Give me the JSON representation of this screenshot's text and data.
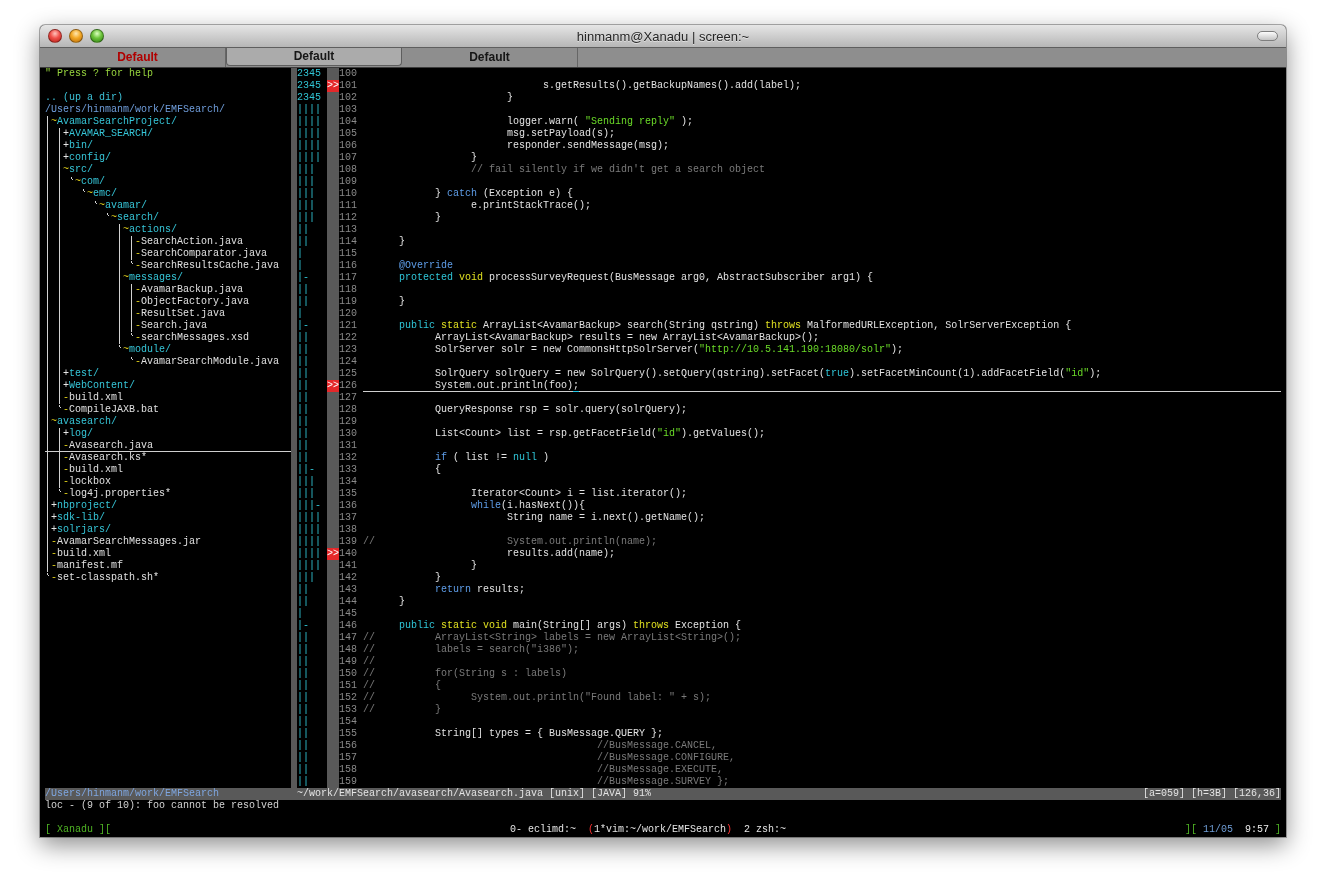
{
  "window": {
    "title": "hinmanm@Xanadu | screen:~"
  },
  "tabs": [
    {
      "label": "Default",
      "selected": false,
      "alert": true
    },
    {
      "label": "Default",
      "selected": true,
      "alert": false
    },
    {
      "label": "Default",
      "selected": false,
      "alert": false
    }
  ],
  "file_tree": {
    "help": "\" Press ? for help",
    "up_dir": ".. (up a dir)",
    "root": "/Users/hinmanm/work/EMFSearch/",
    "nodes": [
      {
        "name": "AvamarSearchProject/",
        "marker": "~",
        "kind": "dir",
        "expanded": true,
        "children": [
          {
            "name": "AVAMAR_SEARCH/",
            "marker": "+",
            "kind": "dir",
            "expanded": false
          },
          {
            "name": "bin/",
            "marker": "+",
            "kind": "dir",
            "expanded": false
          },
          {
            "name": "config/",
            "marker": "+",
            "kind": "dir",
            "expanded": false
          },
          {
            "name": "src/",
            "marker": "~",
            "kind": "dir",
            "expanded": true,
            "children": [
              {
                "name": "com/",
                "marker": "~",
                "kind": "dir",
                "expanded": true,
                "children": [
                  {
                    "name": "emc/",
                    "marker": "~",
                    "kind": "dir",
                    "expanded": true,
                    "children": [
                      {
                        "name": "avamar/",
                        "marker": "~",
                        "kind": "dir",
                        "expanded": true,
                        "children": [
                          {
                            "name": "search/",
                            "marker": "~",
                            "kind": "dir",
                            "expanded": true,
                            "children": [
                              {
                                "name": "actions/",
                                "marker": "~",
                                "kind": "dir",
                                "expanded": true,
                                "children": [
                                  {
                                    "name": "SearchAction.java",
                                    "marker": "-",
                                    "kind": "file"
                                  },
                                  {
                                    "name": "SearchComparator.java",
                                    "marker": "-",
                                    "kind": "file"
                                  },
                                  {
                                    "name": "SearchResultsCache.java",
                                    "marker": "-",
                                    "kind": "file"
                                  }
                                ]
                              },
                              {
                                "name": "messages/",
                                "marker": "~",
                                "kind": "dir",
                                "expanded": true,
                                "children": [
                                  {
                                    "name": "AvamarBackup.java",
                                    "marker": "-",
                                    "kind": "file"
                                  },
                                  {
                                    "name": "ObjectFactory.java",
                                    "marker": "-",
                                    "kind": "file"
                                  },
                                  {
                                    "name": "ResultSet.java",
                                    "marker": "-",
                                    "kind": "file"
                                  },
                                  {
                                    "name": "Search.java",
                                    "marker": "-",
                                    "kind": "file"
                                  },
                                  {
                                    "name": "searchMessages.xsd",
                                    "marker": "-",
                                    "kind": "file"
                                  }
                                ]
                              },
                              {
                                "name": "module/",
                                "marker": "~",
                                "kind": "dir",
                                "expanded": true,
                                "children": [
                                  {
                                    "name": "AvamarSearchModule.java",
                                    "marker": "-",
                                    "kind": "file"
                                  }
                                ]
                              }
                            ]
                          }
                        ]
                      }
                    ]
                  }
                ]
              }
            ]
          },
          {
            "name": "test/",
            "marker": "+",
            "kind": "dir",
            "expanded": false
          },
          {
            "name": "WebContent/",
            "marker": "+",
            "kind": "dir",
            "expanded": false
          },
          {
            "name": "build.xml",
            "marker": "-",
            "kind": "file"
          },
          {
            "name": "CompileJAXB.bat",
            "marker": "-",
            "kind": "file"
          }
        ]
      },
      {
        "name": "avasearch/",
        "marker": "~",
        "kind": "dir",
        "expanded": true,
        "children": [
          {
            "name": "log/",
            "marker": "+",
            "kind": "dir",
            "expanded": false
          },
          {
            "name": "Avasearch.java",
            "marker": "-",
            "kind": "file",
            "cursor_line": true
          },
          {
            "name": "Avasearch.ks*",
            "marker": "-",
            "kind": "file"
          },
          {
            "name": "build.xml",
            "marker": "-",
            "kind": "file"
          },
          {
            "name": "lockbox",
            "marker": "-",
            "kind": "file"
          },
          {
            "name": "log4j.properties*",
            "marker": "-",
            "kind": "file"
          }
        ]
      },
      {
        "name": "nbproject/",
        "marker": "+",
        "kind": "dir",
        "expanded": false
      },
      {
        "name": "sdk-lib/",
        "marker": "+",
        "kind": "dir",
        "expanded": false
      },
      {
        "name": "solrjars/",
        "marker": "+",
        "kind": "dir",
        "expanded": false
      },
      {
        "name": "AvamarSearchMessages.jar",
        "marker": "-",
        "kind": "file"
      },
      {
        "name": "build.xml",
        "marker": "-",
        "kind": "file"
      },
      {
        "name": "manifest.mf",
        "marker": "-",
        "kind": "file"
      },
      {
        "name": "set-classpath.sh*",
        "marker": "-",
        "kind": "file"
      }
    ]
  },
  "editor": {
    "lines": [
      {
        "number": "100",
        "fold": "2345"
      },
      {
        "number": "101",
        "fold": "2345",
        "sign": ">>",
        "segments": [
          {
            "kind": "plain",
            "text": "\t\t\t\t\ts.getResults().getBackupNames().add(label);"
          }
        ]
      },
      {
        "number": "102",
        "fold": "2345",
        "segments": [
          {
            "kind": "plain",
            "text": "\t\t\t\t}"
          }
        ]
      },
      {
        "number": "103",
        "fold": "||||"
      },
      {
        "number": "104",
        "fold": "||||",
        "segments": [
          {
            "kind": "plain",
            "text": "\t\t\t\tlogger.warn( "
          },
          {
            "kind": "string",
            "text": "\"Sending reply\""
          },
          {
            "kind": "plain",
            "text": " );"
          }
        ]
      },
      {
        "number": "105",
        "fold": "||||",
        "segments": [
          {
            "kind": "plain",
            "text": "\t\t\t\tmsg.setPayload(s);"
          }
        ]
      },
      {
        "number": "106",
        "fold": "||||",
        "segments": [
          {
            "kind": "plain",
            "text": "\t\t\t\tresponder.sendMessage(msg);"
          }
        ]
      },
      {
        "number": "107",
        "fold": "||||",
        "segments": [
          {
            "kind": "plain",
            "text": "\t\t\t}"
          }
        ]
      },
      {
        "number": "108",
        "fold": "|||",
        "segments": [
          {
            "kind": "comment",
            "text": "\t\t\t// fail silently if we didn't get a search object"
          }
        ]
      },
      {
        "number": "109",
        "fold": "|||"
      },
      {
        "number": "110",
        "fold": "|||",
        "segments": [
          {
            "kind": "plain",
            "text": "\t\t} "
          },
          {
            "kind": "statement",
            "text": "catch"
          },
          {
            "kind": "plain",
            "text": " (Exception e) {"
          }
        ]
      },
      {
        "number": "111",
        "fold": "|||",
        "segments": [
          {
            "kind": "plain",
            "text": "\t\t\te.printStackTrace();"
          }
        ]
      },
      {
        "number": "112",
        "fold": "|||",
        "segments": [
          {
            "kind": "plain",
            "text": "\t\t}"
          }
        ]
      },
      {
        "number": "113",
        "fold": "||"
      },
      {
        "number": "114",
        "fold": "||",
        "segments": [
          {
            "kind": "plain",
            "text": "\t}"
          }
        ]
      },
      {
        "number": "115",
        "fold": "|"
      },
      {
        "number": "116",
        "fold": "|",
        "segments": [
          {
            "kind": "annotation",
            "text": "\t@Override"
          }
        ]
      },
      {
        "number": "117",
        "fold": "|-",
        "segments": [
          {
            "kind": "keyword",
            "text": "\tprotected"
          },
          {
            "kind": "type",
            "text": " void"
          },
          {
            "kind": "plain",
            "text": " processSurveyRequest(BusMessage arg0, AbstractSubscriber arg1) {"
          }
        ]
      },
      {
        "number": "118",
        "fold": "||"
      },
      {
        "number": "119",
        "fold": "||",
        "segments": [
          {
            "kind": "plain",
            "text": "\t}"
          }
        ]
      },
      {
        "number": "120",
        "fold": "|"
      },
      {
        "number": "121",
        "fold": "|-",
        "segments": [
          {
            "kind": "keyword",
            "text": "\tpublic"
          },
          {
            "kind": "type",
            "text": " static"
          },
          {
            "kind": "plain",
            "text": " ArrayList<AvamarBackup> search(String qstring) "
          },
          {
            "kind": "type",
            "text": "throws"
          },
          {
            "kind": "plain",
            "text": " MalformedURLException, SolrServerException {"
          }
        ]
      },
      {
        "number": "122",
        "fold": "||",
        "segments": [
          {
            "kind": "plain",
            "text": "\t\tArrayList<AvamarBackup> results = new ArrayList<AvamarBackup>();"
          }
        ]
      },
      {
        "number": "123",
        "fold": "||",
        "segments": [
          {
            "kind": "plain",
            "text": "\t\tSolrServer solr = new CommonsHttpSolrServer("
          },
          {
            "kind": "string",
            "text": "\"http://10.5.141.190:18080/solr\""
          },
          {
            "kind": "plain",
            "text": ");"
          }
        ]
      },
      {
        "number": "124",
        "fold": "||"
      },
      {
        "number": "125",
        "fold": "||",
        "segments": [
          {
            "kind": "plain",
            "text": "\t\tSolrQuery solrQuery = new SolrQuery().setQuery(qstring).setFacet("
          },
          {
            "kind": "keyword",
            "text": "true"
          },
          {
            "kind": "plain",
            "text": ").setFacetMinCount(1).addFacetField("
          },
          {
            "kind": "string",
            "text": "\"id\""
          },
          {
            "kind": "plain",
            "text": ");"
          }
        ]
      },
      {
        "number": "126",
        "fold": "||",
        "sign": ">>",
        "cursor_line": true,
        "segments": [
          {
            "kind": "plain",
            "text": "\t\tSystem.out.println(foo)"
          },
          {
            "kind": "cursor",
            "text": ";"
          }
        ]
      },
      {
        "number": "127",
        "fold": "||"
      },
      {
        "number": "128",
        "fold": "||",
        "segments": [
          {
            "kind": "plain",
            "text": "\t\tQueryResponse rsp = solr.query(solrQuery);"
          }
        ]
      },
      {
        "number": "129",
        "fold": "||"
      },
      {
        "number": "130",
        "fold": "||",
        "segments": [
          {
            "kind": "plain",
            "text": "\t\tList<Count> list = rsp.getFacetField("
          },
          {
            "kind": "string",
            "text": "\"id\""
          },
          {
            "kind": "plain",
            "text": ").getValues();"
          }
        ]
      },
      {
        "number": "131",
        "fold": "||"
      },
      {
        "number": "132",
        "fold": "||",
        "segments": [
          {
            "kind": "statement",
            "text": "\t\tif"
          },
          {
            "kind": "plain",
            "text": " ( list != "
          },
          {
            "kind": "keyword",
            "text": "null"
          },
          {
            "kind": "plain",
            "text": " )"
          }
        ]
      },
      {
        "number": "133",
        "fold": "||-",
        "segments": [
          {
            "kind": "plain",
            "text": "\t\t{"
          }
        ]
      },
      {
        "number": "134",
        "fold": "|||"
      },
      {
        "number": "135",
        "fold": "|||",
        "segments": [
          {
            "kind": "plain",
            "text": "\t\t\tIterator<Count> i = list.iterator();"
          }
        ]
      },
      {
        "number": "136",
        "fold": "|||-",
        "segments": [
          {
            "kind": "statement",
            "text": "\t\t\twhile"
          },
          {
            "kind": "plain",
            "text": "(i.hasNext()){"
          }
        ]
      },
      {
        "number": "137",
        "fold": "||||",
        "segments": [
          {
            "kind": "plain",
            "text": "\t\t\t\tString name = i.next().getName();"
          }
        ]
      },
      {
        "number": "138",
        "fold": "||||"
      },
      {
        "number": "139",
        "fold": "||||",
        "segments": [
          {
            "kind": "comment",
            "text": "//\t\t\t\tSystem.out.println(name);"
          }
        ]
      },
      {
        "number": "140",
        "fold": "||||",
        "sign": ">>",
        "segments": [
          {
            "kind": "plain",
            "text": "\t\t\t\tresults.add(name);"
          }
        ]
      },
      {
        "number": "141",
        "fold": "||||",
        "segments": [
          {
            "kind": "plain",
            "text": "\t\t\t}"
          }
        ]
      },
      {
        "number": "142",
        "fold": "|||",
        "segments": [
          {
            "kind": "plain",
            "text": "\t\t}"
          }
        ]
      },
      {
        "number": "143",
        "fold": "||",
        "segments": [
          {
            "kind": "statement",
            "text": "\t\treturn"
          },
          {
            "kind": "plain",
            "text": " results;"
          }
        ]
      },
      {
        "number": "144",
        "fold": "||",
        "segments": [
          {
            "kind": "plain",
            "text": "\t}"
          }
        ]
      },
      {
        "number": "145",
        "fold": "|"
      },
      {
        "number": "146",
        "fold": "|-",
        "segments": [
          {
            "kind": "keyword",
            "text": "\tpublic"
          },
          {
            "kind": "type",
            "text": " static void"
          },
          {
            "kind": "plain",
            "text": " main(String[] args) "
          },
          {
            "kind": "type",
            "text": "throws"
          },
          {
            "kind": "plain",
            "text": " Exception {"
          }
        ]
      },
      {
        "number": "147",
        "fold": "||",
        "segments": [
          {
            "kind": "comment",
            "text": "//\t\tArrayList<String> labels = new ArrayList<String>();"
          }
        ]
      },
      {
        "number": "148",
        "fold": "||",
        "segments": [
          {
            "kind": "comment",
            "text": "//\t\tlabels = search(\"i386\");"
          }
        ]
      },
      {
        "number": "149",
        "fold": "||",
        "segments": [
          {
            "kind": "comment",
            "text": "//"
          }
        ]
      },
      {
        "number": "150",
        "fold": "||",
        "segments": [
          {
            "kind": "comment",
            "text": "//\t\tfor(String s : labels)"
          }
        ]
      },
      {
        "number": "151",
        "fold": "||",
        "segments": [
          {
            "kind": "comment",
            "text": "//\t\t{"
          }
        ]
      },
      {
        "number": "152",
        "fold": "||",
        "segments": [
          {
            "kind": "comment",
            "text": "//\t\t\tSystem.out.println(\"Found label: \" + s);"
          }
        ]
      },
      {
        "number": "153",
        "fold": "||",
        "segments": [
          {
            "kind": "comment",
            "text": "//\t\t}"
          }
        ]
      },
      {
        "number": "154",
        "fold": "||"
      },
      {
        "number": "155",
        "fold": "||",
        "segments": [
          {
            "kind": "plain",
            "text": "\t\tString[] types = { BusMessage.QUERY };"
          }
        ]
      },
      {
        "number": "156",
        "fold": "||",
        "segments": [
          {
            "kind": "comment",
            "text": "\t\t\t\t\t\t   //BusMessage.CANCEL,"
          }
        ]
      },
      {
        "number": "157",
        "fold": "||",
        "segments": [
          {
            "kind": "comment",
            "text": "\t\t\t\t\t\t   //BusMessage.CONFIGURE,"
          }
        ]
      },
      {
        "number": "158",
        "fold": "||",
        "segments": [
          {
            "kind": "comment",
            "text": "\t\t\t\t\t\t   //BusMessage.EXECUTE,"
          }
        ]
      },
      {
        "number": "159",
        "fold": "||",
        "segments": [
          {
            "kind": "comment",
            "text": "\t\t\t\t\t\t   //BusMessage.SURVEY };"
          }
        ]
      }
    ]
  },
  "status_line": {
    "tree_path": "/Users/hinmanm/work/EMFSearch",
    "file_info": "~/work/EMFSearch/avasearch/Avasearch.java [unix] [JAVA] 91%",
    "position": "[a=059] [h=3B] [126,36]"
  },
  "message": "loc - (9 of 10): foo cannot be resolved",
  "screen_bar": {
    "host": "[ Xanadu ][",
    "windows": [
      {
        "text": "0- eclimd:~",
        "selected": false
      },
      {
        "text": "(1*vim:~/work/EMFSearch)",
        "selected": true
      },
      {
        "text": "2 zsh:~",
        "selected": false
      }
    ],
    "clock": [
      {
        "kind": "bracket",
        "text": "]["
      },
      {
        "kind": "date",
        "text": "11/05"
      },
      {
        "kind": "time",
        "text": "9:57"
      },
      {
        "kind": "bracket",
        "text": "]"
      }
    ]
  }
}
